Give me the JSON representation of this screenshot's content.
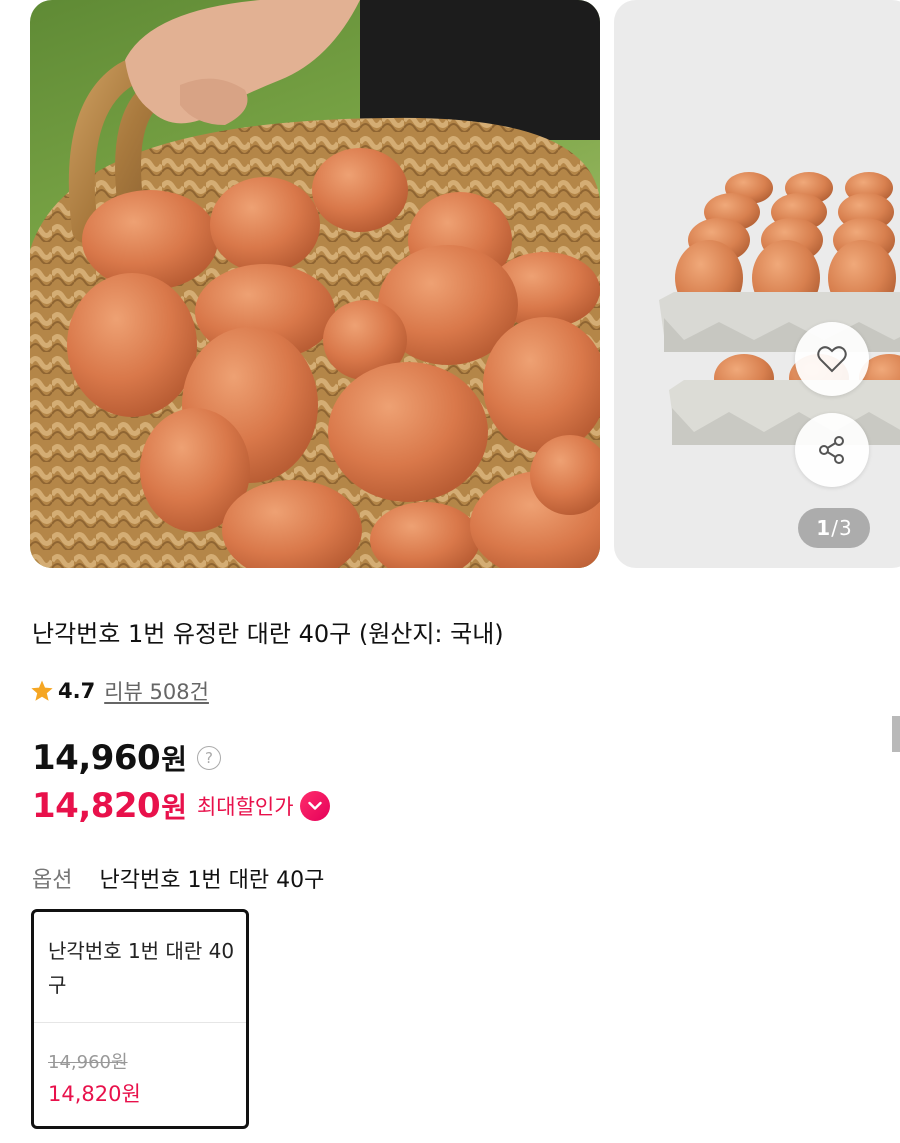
{
  "carousel": {
    "current": "1",
    "total": "3",
    "like_icon": "heart-outline-icon",
    "share_icon": "share-icon"
  },
  "product": {
    "title": "난각번호 1번 유정란 대란 40구 (원산지: 국내)",
    "rating": "4.7",
    "review_text": "리뷰 508건",
    "price": "14,960",
    "currency": "원",
    "sale_price": "14,820",
    "discount_label": "최대할인가"
  },
  "option": {
    "label": "옵션",
    "selected": "난각번호 1번 대란 40구",
    "card": {
      "name": "난각번호 1번 대란 40구",
      "original_price": "14,960원",
      "sale_price": "14,820원"
    }
  },
  "colors": {
    "accent": "#e8114b",
    "star": "#f5a623",
    "text": "#111111",
    "muted": "#777777"
  }
}
